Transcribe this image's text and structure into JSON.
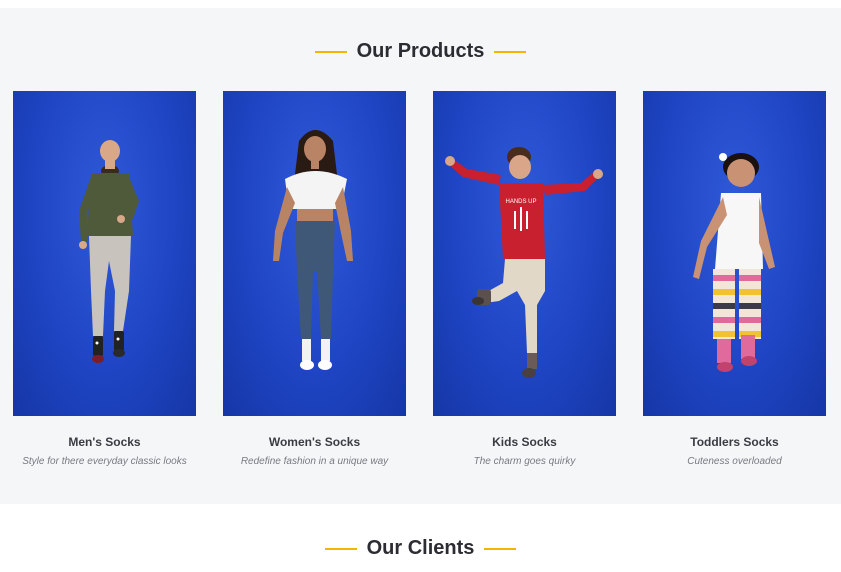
{
  "products_section": {
    "heading": "Our Products",
    "items": [
      {
        "name": "Men's Socks",
        "tagline": "Style for there everyday classic looks"
      },
      {
        "name": "Women's Socks",
        "tagline": "Redefine fashion in a unique way"
      },
      {
        "name": "Kids Socks",
        "tagline": "The charm goes quirky"
      },
      {
        "name": "Toddlers Socks",
        "tagline": "Cuteness overloaded"
      }
    ]
  },
  "clients_section": {
    "heading": "Our Clients"
  },
  "colors": {
    "accent": "#f5b400",
    "photo_background": "#1f45c4",
    "section_background": "#f4f6f8"
  }
}
